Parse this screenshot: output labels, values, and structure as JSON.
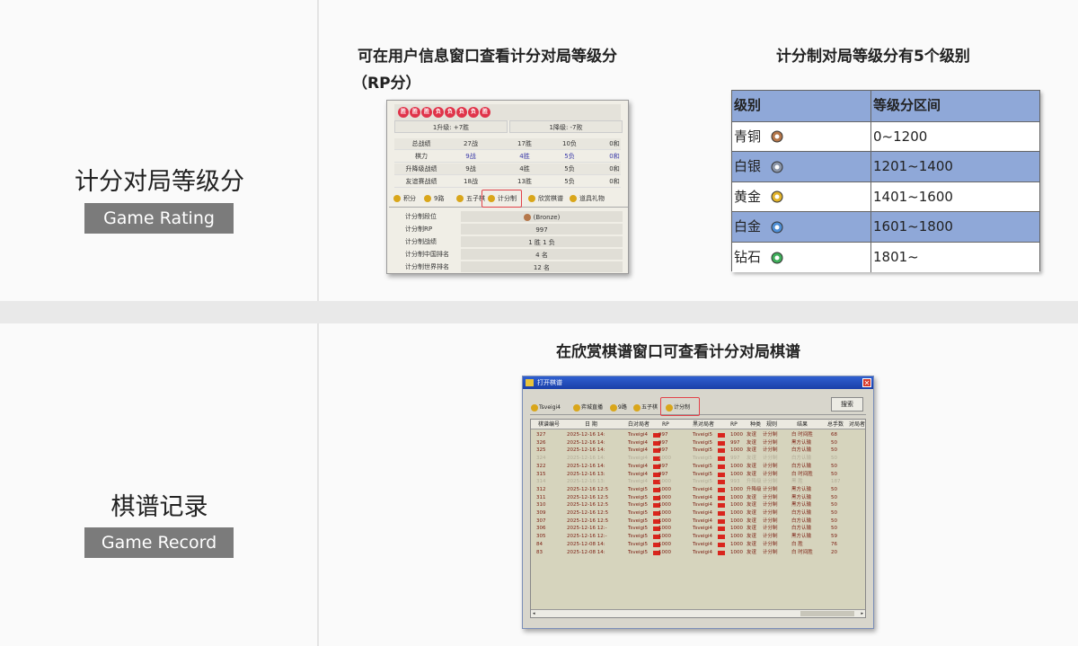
{
  "sections": [
    {
      "title": "计分对局等级分",
      "badge": "Game Rating"
    },
    {
      "title": "棋谱记录",
      "badge": "Game Record"
    }
  ],
  "captions": {
    "user_info_line1": "可在用户信息窗口查看计分对局等级分",
    "user_info_line2": "（RP分）",
    "tiers": "计分制对局等级分有5个级别",
    "game_record": "在欣赏棋谱窗口可查看计分对局棋谱"
  },
  "user_window": {
    "badges": [
      "胜",
      "胜",
      "胜",
      "负",
      "负",
      "负",
      "负",
      "胜"
    ],
    "promote": "1升级: +7胜",
    "demote": "1降级: -7败",
    "stats": [
      {
        "label": "总战绩",
        "games": "27战",
        "win": "17胜",
        "lose": "10负",
        "draw": "0和"
      },
      {
        "label": "棋力",
        "games": "9战",
        "win": "4胜",
        "lose": "5负",
        "draw": "0和"
      },
      {
        "label": "升降级战绩",
        "games": "9战",
        "win": "4胜",
        "lose": "5负",
        "draw": "0和"
      },
      {
        "label": "友谊赛战绩",
        "games": "18战",
        "win": "13胜",
        "lose": "5负",
        "draw": "0和"
      }
    ],
    "tabs": [
      "积分",
      "9路",
      "五子棋",
      "计分制",
      "欣赏棋谱",
      "道具礼物"
    ],
    "scoring": [
      {
        "label": "计分制段位",
        "value": "(Bronze)"
      },
      {
        "label": "计分制RP",
        "value": "997"
      },
      {
        "label": "计分制战绩",
        "value": "1 胜 1 负"
      },
      {
        "label": "计分制中国排名",
        "value": "4 名"
      },
      {
        "label": "计分制世界排名",
        "value": "12 名"
      }
    ]
  },
  "tier_table": {
    "headers": [
      "级别",
      "等级分区间"
    ],
    "rows": [
      {
        "name": "青铜",
        "range": "0~1200",
        "medal": "bronze-medal-icon",
        "color": "#b5774a",
        "highlight": false
      },
      {
        "name": "白银",
        "range": "1201~1400",
        "medal": "silver-medal-icon",
        "color": "#8a95a8",
        "highlight": true
      },
      {
        "name": "黄金",
        "range": "1401~1600",
        "medal": "gold-medal-icon",
        "color": "#e2b32a",
        "highlight": false
      },
      {
        "name": "白金",
        "range": "1601~1800",
        "medal": "platinum-medal-icon",
        "color": "#4f8fd6",
        "highlight": true
      },
      {
        "name": "钻石",
        "range": "1801~",
        "medal": "diamond-medal-icon",
        "color": "#3fae5a",
        "highlight": false
      }
    ],
    "header_bg": "#8fa8d8",
    "highlight_bg": "#8fa8d8"
  },
  "record_window": {
    "title": "打开棋谱",
    "close": "✕",
    "tabs": [
      "Tsveigi4",
      "弈城直播",
      "9路",
      "五子棋",
      "计分制"
    ],
    "search_button": "搜索",
    "headers": [
      "棋谱编号",
      "日 期",
      "白对局者",
      "RP",
      "黑对局者",
      "RP",
      "种类",
      "规则",
      "结果",
      "总手数",
      "对局者"
    ],
    "rows": [
      {
        "id": "327",
        "date": "2025-12-16 14:",
        "white": "Tsveigi4",
        "wrp": "997",
        "black": "Tsveigi5",
        "brp": "1000",
        "kind": "友谊",
        "rule": "计分制",
        "result": "白 时间胜",
        "moves": "68",
        "dim": false
      },
      {
        "id": "326",
        "date": "2025-12-16 14:",
        "white": "Tsveigi4",
        "wrp": "997",
        "black": "Tsveigi5",
        "brp": "997",
        "kind": "友谊",
        "rule": "计分制",
        "result": "黑方认输",
        "moves": "50",
        "dim": false
      },
      {
        "id": "325",
        "date": "2025-12-16 14:",
        "white": "Tsveigi4",
        "wrp": "997",
        "black": "Tsveigi5",
        "brp": "1000",
        "kind": "友谊",
        "rule": "计分制",
        "result": "白方认输",
        "moves": "50",
        "dim": false
      },
      {
        "id": "324",
        "date": "2025-12-16 14:",
        "white": "Tsveigi4",
        "wrp": "1000",
        "black": "Tsveigi5",
        "brp": "997",
        "kind": "友谊",
        "rule": "计分制",
        "result": "白方认输",
        "moves": "50",
        "dim": true
      },
      {
        "id": "322",
        "date": "2025-12-16 14:",
        "white": "Tsveigi4",
        "wrp": "997",
        "black": "Tsveigi5",
        "brp": "1000",
        "kind": "友谊",
        "rule": "计分制",
        "result": "白方认输",
        "moves": "50",
        "dim": false
      },
      {
        "id": "315",
        "date": "2025-12-16 13:",
        "white": "Tsveigi4",
        "wrp": "997",
        "black": "Tsveigi5",
        "brp": "1000",
        "kind": "友谊",
        "rule": "计分制",
        "result": "白 时间胜",
        "moves": "50",
        "dim": false
      },
      {
        "id": "314",
        "date": "2025-12-16 13:",
        "white": "Tsveigi4",
        "wrp": "1000",
        "black": "Tsveigi5",
        "brp": "993",
        "kind": "升降级",
        "rule": "计分制",
        "result": "黑 胜",
        "moves": "187",
        "dim": true
      },
      {
        "id": "312",
        "date": "2025-12-16 12:5",
        "white": "Tsveigi5",
        "wrp": "1000",
        "black": "Tsveigi4",
        "brp": "1000",
        "kind": "升降级",
        "rule": "计分制",
        "result": "黑方认输",
        "moves": "50",
        "dim": false
      },
      {
        "id": "311",
        "date": "2025-12-16 12:5",
        "white": "Tsveigi5",
        "wrp": "1000",
        "black": "Tsveigi4",
        "brp": "1000",
        "kind": "友谊",
        "rule": "计分制",
        "result": "黑方认输",
        "moves": "50",
        "dim": false
      },
      {
        "id": "310",
        "date": "2025-12-16 12:5",
        "white": "Tsveigi5",
        "wrp": "1000",
        "black": "Tsveigi4",
        "brp": "1000",
        "kind": "友谊",
        "rule": "计分制",
        "result": "黑方认输",
        "moves": "50",
        "dim": false
      },
      {
        "id": "309",
        "date": "2025-12-16 12:5",
        "white": "Tsveigi5",
        "wrp": "1000",
        "black": "Tsveigi4",
        "brp": "1000",
        "kind": "友谊",
        "rule": "计分制",
        "result": "白方认输",
        "moves": "50",
        "dim": false
      },
      {
        "id": "307",
        "date": "2025-12-16 12:5",
        "white": "Tsveigi5",
        "wrp": "1000",
        "black": "Tsveigi4",
        "brp": "1000",
        "kind": "友谊",
        "rule": "计分制",
        "result": "白方认输",
        "moves": "50",
        "dim": false
      },
      {
        "id": "306",
        "date": "2025-12-16 12:-",
        "white": "Tsveigi5",
        "wrp": "1000",
        "black": "Tsveigi4",
        "brp": "1000",
        "kind": "友谊",
        "rule": "计分制",
        "result": "白方认输",
        "moves": "50",
        "dim": false
      },
      {
        "id": "305",
        "date": "2025-12-16 12:-",
        "white": "Tsveigi5",
        "wrp": "1000",
        "black": "Tsveigi4",
        "brp": "1000",
        "kind": "友谊",
        "rule": "计分制",
        "result": "黑方认输",
        "moves": "59",
        "dim": false
      },
      {
        "id": "84",
        "date": "2025-12-08 14:",
        "white": "Tsveigi5",
        "wrp": "1000",
        "black": "Tsveigi4",
        "brp": "1000",
        "kind": "友谊",
        "rule": "计分制",
        "result": "白 胜",
        "moves": "76",
        "dim": false
      },
      {
        "id": "83",
        "date": "2025-12-08 14:",
        "white": "Tsveigi5",
        "wrp": "1000",
        "black": "Tsveigi4",
        "brp": "1000",
        "kind": "友谊",
        "rule": "计分制",
        "result": "白 时间胜",
        "moves": "20",
        "dim": false
      }
    ]
  },
  "accent": "#e2424a"
}
